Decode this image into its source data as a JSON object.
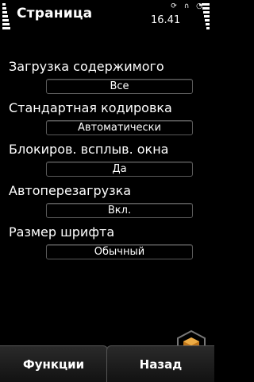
{
  "status": {
    "title": "Страница",
    "time": "16.41"
  },
  "settings": [
    {
      "label": "Загрузка содержимого",
      "value": "Все"
    },
    {
      "label": "Стандартная кодировка",
      "value": "Автоматически"
    },
    {
      "label": "Блокиров. всплыв. окна",
      "value": "Да"
    },
    {
      "label": "Автоперезагрузка",
      "value": "Вкл."
    },
    {
      "label": "Размер шрифта",
      "value": "Обычный"
    }
  ],
  "softkeys": {
    "left": "Функции",
    "right": "Назад"
  },
  "colors": {
    "background": "#000000",
    "field_border": "#5a5a5a",
    "softkey_top": "#2a2a2a",
    "watermark_orange": "#e08a1e"
  }
}
